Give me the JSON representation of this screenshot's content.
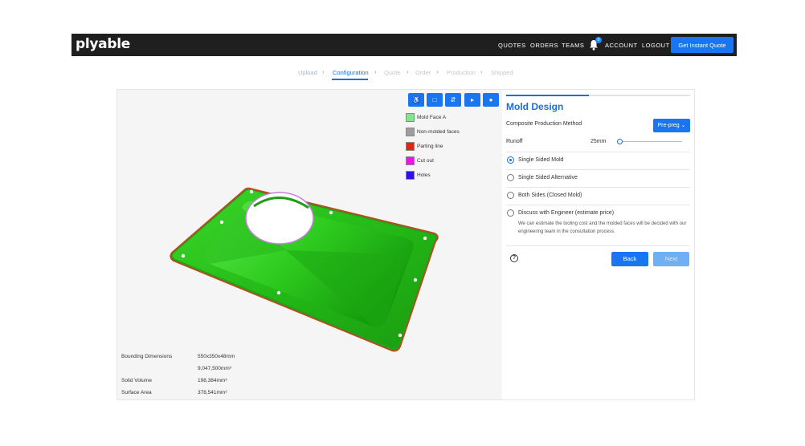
{
  "header": {
    "logo": "plyable",
    "nav": [
      "QUOTES",
      "ORDERS",
      "TEAMS",
      "ACCOUNT",
      "LOGOUT"
    ],
    "notification_count": "0",
    "cta": "Get Instant Quote"
  },
  "steps": [
    "Upload",
    "Configuration",
    "Quote",
    "Order",
    "Production",
    "Shipped"
  ],
  "toolbar": {
    "icons": [
      "accessibility-icon",
      "square-icon",
      "swap-icon",
      "play-icon",
      "circle-icon"
    ],
    "glyphs": [
      "♿",
      "□",
      "⇵",
      "▸",
      "●"
    ]
  },
  "legend": [
    {
      "label": "Mold Face A",
      "color": "#7ee88a"
    },
    {
      "label": "Non-molded faces",
      "color": "#9e9e9e"
    },
    {
      "label": "Parting line",
      "color": "#e0241b"
    },
    {
      "label": "Cut out",
      "color": "#ea16e6"
    },
    {
      "label": "Holes",
      "color": "#2a12e6"
    }
  ],
  "stats": [
    {
      "label": "Bounding Dimensions",
      "value": "550x350x48mm"
    },
    {
      "label": "",
      "value": "9,047,500mm³"
    },
    {
      "label": "Solid Volume",
      "value": "198,384mm³"
    },
    {
      "label": "Surface Area",
      "value": "378,541mm²"
    }
  ],
  "panel": {
    "progress": 0.45,
    "title": "Mold Design",
    "method_label": "Composite Production Method",
    "method_value": "Pre-preg",
    "runoff_label": "Runoff",
    "runoff_value": "25mm",
    "runoff_fraction": 0.02,
    "options": [
      {
        "label": "Single Sided Mold",
        "checked": true,
        "desc": ""
      },
      {
        "label": "Single Sided Alternative",
        "checked": false,
        "desc": ""
      },
      {
        "label": "Both Sides (Closed Mold)",
        "checked": false,
        "desc": ""
      },
      {
        "label": "Discuss with Engineer (estimate price)",
        "checked": false,
        "desc": "We can estimate the tooling cost and the molded faces will be decided with our engineering team in the consultation process."
      }
    ],
    "help": "?",
    "back": "Back",
    "next": "Next"
  },
  "colors": {
    "accent": "#1976f0",
    "part_green": "#2fc21f",
    "topbar": "#1f1f1f"
  }
}
